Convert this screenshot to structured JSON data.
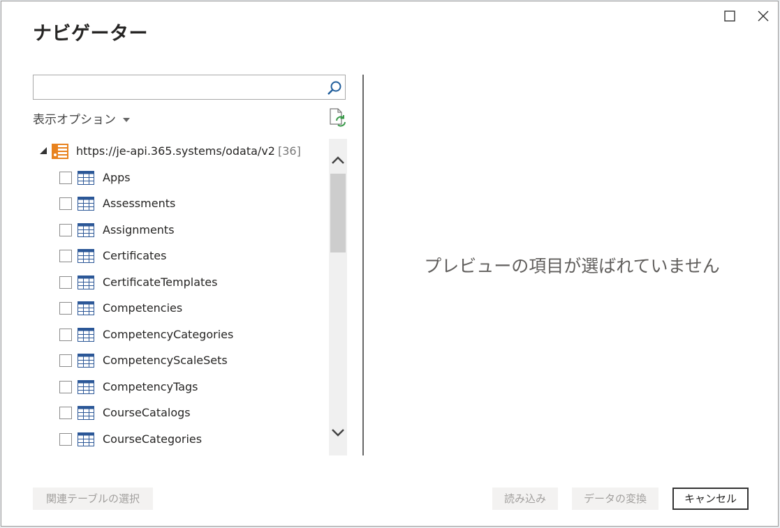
{
  "window": {
    "title": "ナビゲーター",
    "maximize_icon": "maximize-icon",
    "close_icon": "close-icon"
  },
  "search": {
    "value": "",
    "placeholder": "",
    "icon": "search-icon"
  },
  "display_options": {
    "label": "表示オプション",
    "icon": "chevron-down-icon"
  },
  "refresh": {
    "icon": "refresh-document-icon"
  },
  "tree": {
    "root": {
      "label": "https://je-api.365.systems/odata/v2",
      "count": "[36]",
      "icon": "odata-feed-icon"
    },
    "items": [
      {
        "label": "Apps"
      },
      {
        "label": "Assessments"
      },
      {
        "label": "Assignments"
      },
      {
        "label": "Certificates"
      },
      {
        "label": "CertificateTemplates"
      },
      {
        "label": "Competencies"
      },
      {
        "label": "CompetencyCategories"
      },
      {
        "label": "CompetencyScaleSets"
      },
      {
        "label": "CompetencyTags"
      },
      {
        "label": "CourseCatalogs"
      },
      {
        "label": "CourseCategories"
      }
    ]
  },
  "preview": {
    "message": "プレビューの項目が選ばれていません"
  },
  "footer": {
    "select_related": "関連テーブルの選択",
    "load": "読み込み",
    "transform": "データの変換",
    "cancel": "キャンセル"
  },
  "colors": {
    "accent_orange": "#e8821e",
    "table_icon_blue": "#2b5797",
    "text": "#252423"
  }
}
